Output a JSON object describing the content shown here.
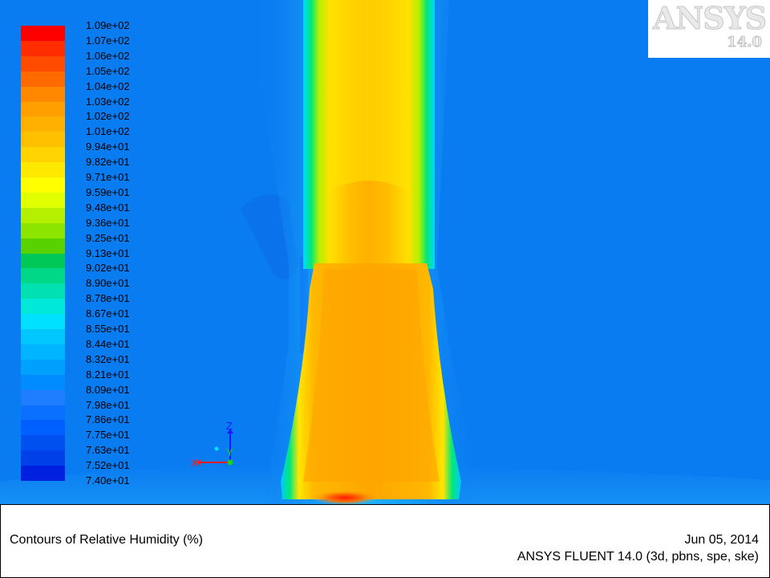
{
  "colors": {
    "background": "#0a7cf2",
    "plume_core": "#ffa200",
    "plume_inner": "#ffb400",
    "plume_edge": "#ffe000",
    "hot_spot": "#ff2a00"
  },
  "colorbar": {
    "labels": [
      "1.09e+02",
      "1.07e+02",
      "1.06e+02",
      "1.05e+02",
      "1.04e+02",
      "1.03e+02",
      "1.02e+02",
      "1.01e+02",
      "9.94e+01",
      "9.82e+01",
      "9.71e+01",
      "9.59e+01",
      "9.48e+01",
      "9.36e+01",
      "9.25e+01",
      "9.13e+01",
      "9.02e+01",
      "8.90e+01",
      "8.78e+01",
      "8.67e+01",
      "8.55e+01",
      "8.44e+01",
      "8.32e+01",
      "8.21e+01",
      "8.09e+01",
      "7.98e+01",
      "7.86e+01",
      "7.75e+01",
      "7.63e+01",
      "7.52e+01",
      "7.40e+01"
    ],
    "colors": [
      "#ff0000",
      "#ff2d00",
      "#ff4b00",
      "#ff6a00",
      "#ff8800",
      "#ffa000",
      "#ffb000",
      "#ffc000",
      "#ffd400",
      "#ffe800",
      "#ffff00",
      "#e0ff00",
      "#b4f000",
      "#8ce600",
      "#5ad200",
      "#00c858",
      "#00d887",
      "#00e0b0",
      "#00e8d8",
      "#00e0ff",
      "#00c8ff",
      "#00b4ff",
      "#00a0ff",
      "#008cff",
      "#1e7eff",
      "#0a70ff",
      "#0060ff",
      "#0050f0",
      "#0040e8",
      "#0020e0"
    ]
  },
  "logo": {
    "brand": "ANSYS",
    "version": "14.0"
  },
  "axes": {
    "x": "X",
    "y": "Y",
    "z": "Z"
  },
  "footer": {
    "title": "Contours of Relative Humidity (%)",
    "date": "Jun 05, 2014",
    "solver": "ANSYS FLUENT 14.0 (3d, pbns, spe, ske)"
  }
}
